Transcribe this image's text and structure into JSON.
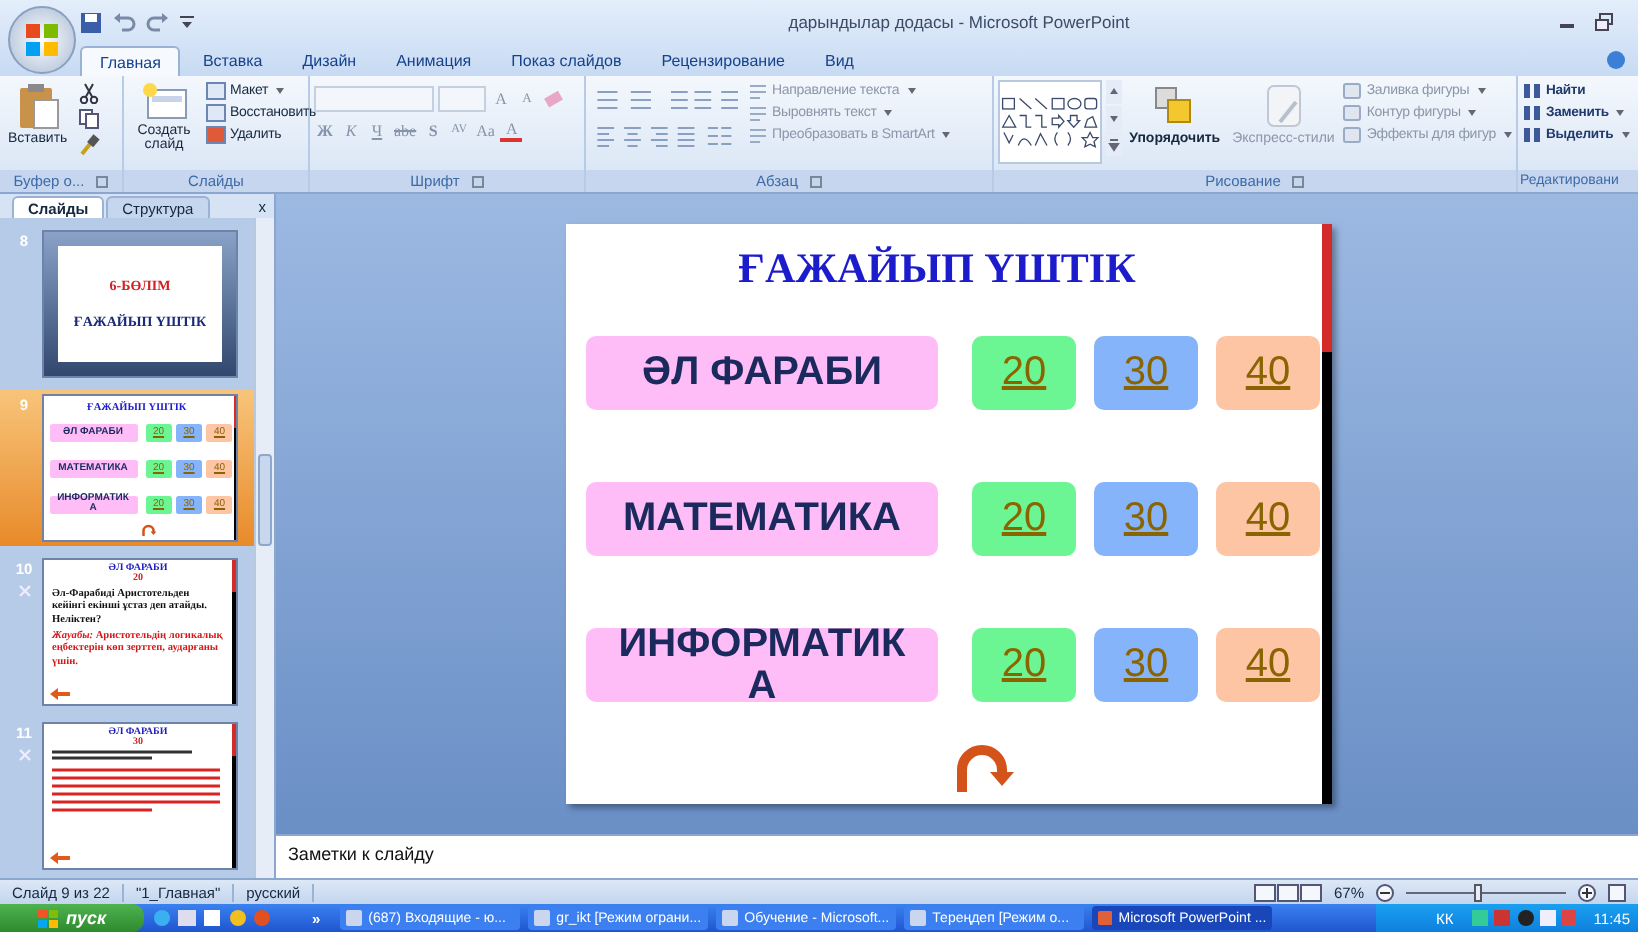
{
  "window": {
    "title": "дарындылар додасы - Microsoft PowerPoint"
  },
  "ribbon_tabs": [
    {
      "label": "Главная",
      "selected": true
    },
    {
      "label": "Вставка",
      "selected": false
    },
    {
      "label": "Дизайн",
      "selected": false
    },
    {
      "label": "Анимация",
      "selected": false
    },
    {
      "label": "Показ слайдов",
      "selected": false
    },
    {
      "label": "Рецензирование",
      "selected": false
    },
    {
      "label": "Вид",
      "selected": false
    }
  ],
  "ribbon_groups": [
    {
      "kind": "clipboard",
      "label": "Буфер о...",
      "paste": "Вставить"
    },
    {
      "kind": "slides",
      "label": "Слайды",
      "new_slide": "Создать слайд",
      "commands": [
        {
          "label": "Макет",
          "menu": true,
          "disabled": false
        },
        {
          "label": "Восстановить",
          "menu": false,
          "disabled": false
        },
        {
          "label": "Удалить",
          "menu": false,
          "disabled": false
        }
      ]
    },
    {
      "kind": "font",
      "label": "Шрифт",
      "size_buttons": [
        "A",
        "A"
      ],
      "format_buttons": [
        "Ж",
        "К",
        "Ч",
        "abe",
        "S",
        "AV",
        "Aa",
        "A"
      ]
    },
    {
      "kind": "paragraph",
      "label": "Абзац",
      "commands": [
        {
          "label": "Направление текста",
          "menu": true,
          "disabled": true
        },
        {
          "label": "Выровнять текст",
          "menu": true,
          "disabled": true
        },
        {
          "label": "Преобразовать в SmartArt",
          "menu": true,
          "disabled": true
        }
      ]
    },
    {
      "kind": "drawing",
      "label": "Рисование",
      "arrange": "Упорядочить",
      "quick_styles": {
        "label": "Экспресс-стили",
        "disabled": true
      },
      "commands": [
        {
          "label": "Заливка фигуры",
          "menu": true,
          "disabled": true
        },
        {
          "label": "Контур фигуры",
          "menu": true,
          "disabled": true
        },
        {
          "label": "Эффекты для фигур",
          "menu": true,
          "disabled": true
        }
      ]
    },
    {
      "kind": "editing",
      "label": "Редактировани",
      "commands": [
        {
          "label": "Найти",
          "menu": false,
          "disabled": false
        },
        {
          "label": "Заменить",
          "menu": true,
          "disabled": false
        },
        {
          "label": "Выделить",
          "menu": true,
          "disabled": false
        }
      ]
    }
  ],
  "slides_panel": {
    "tabs": [
      {
        "label": "Слайды",
        "selected": true
      },
      {
        "label": "Структура",
        "selected": false
      }
    ],
    "close": "x",
    "thumbnails": [
      {
        "kind": "section",
        "number": "8",
        "selected": false,
        "section": "6-БӨЛІМ",
        "title": "ҒАЖАЙЫП ҮШТІК"
      },
      {
        "kind": "board",
        "number": "9",
        "selected": true,
        "title": "ҒАЖАЙЫП ҮШТІК",
        "rows": [
          {
            "category": "ӘЛ ФАРАБИ",
            "scores": [
              {
                "label": "20",
                "color": "#6cf593"
              },
              {
                "label": "30",
                "color": "#86b4fb"
              },
              {
                "label": "40",
                "color": "#fdc5a3"
              }
            ]
          },
          {
            "category": "МАТЕМАТИКА",
            "scores": [
              {
                "label": "20",
                "color": "#6cf593"
              },
              {
                "label": "30",
                "color": "#86b4fb"
              },
              {
                "label": "40",
                "color": "#fdc5a3"
              }
            ]
          },
          {
            "category": "ИНФОРМАТИКА",
            "scores": [
              {
                "label": "20",
                "color": "#6cf593"
              },
              {
                "label": "30",
                "color": "#86b4fb"
              },
              {
                "label": "40",
                "color": "#fdc5a3"
              }
            ]
          }
        ]
      },
      {
        "kind": "question",
        "number": "10",
        "selected": false,
        "heading": "ӘЛ ФАРАБИ",
        "points": "20",
        "question": "Әл-Фарабиді Аристотельден кейінгі екінші ұстаз деп атайды. Неліктен?",
        "answer": "*Жауабы:* Аристотельдің логикалық еңбектерін көп зерттеп, аударғаны үшін."
      },
      {
        "kind": "question",
        "number": "11",
        "selected": false,
        "heading": "ӘЛ ФАРАБИ",
        "points": "30"
      }
    ]
  },
  "slide": {
    "title": "ҒАЖАЙЫП ҮШТІК",
    "rows": [
      {
        "category": "ӘЛ ФАРАБИ",
        "scores": [
          {
            "label": "20",
            "color": "#6cf593"
          },
          {
            "label": "30",
            "color": "#86b4fb"
          },
          {
            "label": "40",
            "color": "#fdc5a3"
          }
        ]
      },
      {
        "category": "МАТЕМАТИКА",
        "scores": [
          {
            "label": "20",
            "color": "#6cf593"
          },
          {
            "label": "30",
            "color": "#86b4fb"
          },
          {
            "label": "40",
            "color": "#fdc5a3"
          }
        ]
      },
      {
        "category": "ИНФОРМАТИКА",
        "scores": [
          {
            "label": "20",
            "color": "#6cf593"
          },
          {
            "label": "30",
            "color": "#86b4fb"
          },
          {
            "label": "40",
            "color": "#fdc5a3"
          }
        ]
      }
    ]
  },
  "notes": {
    "placeholder": "Заметки к слайду"
  },
  "status_bar": {
    "slide": "Слайд 9 из 22",
    "theme": "\"1_Главная\"",
    "language": "русский",
    "zoom": "67%",
    "zoom_slider": {
      "level": 0.45
    }
  },
  "taskbar": {
    "start": "пуск",
    "more": "»",
    "tasks": [
      {
        "label": "(687) Входящие - ю...",
        "selected": false
      },
      {
        "label": "gr_ikt [Режим ограни...",
        "selected": false
      },
      {
        "label": "Обучение - Microsoft...",
        "selected": false
      },
      {
        "label": "Тереңдеп [Режим о...",
        "selected": false
      },
      {
        "label": "Microsoft PowerPoint ...",
        "selected": true
      }
    ],
    "language": "КК",
    "clock": "11:45"
  }
}
